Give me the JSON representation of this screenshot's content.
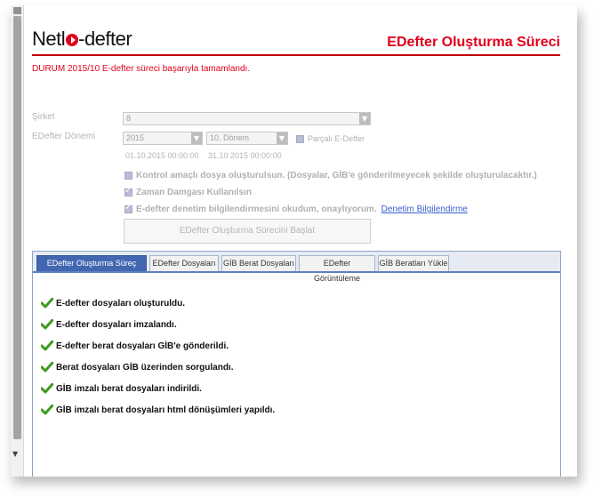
{
  "header": {
    "logo_left": "Netl",
    "logo_right": "-defter",
    "title": "EDefter Oluşturma Süreci"
  },
  "status": "DURUM 2015/10 E-defter süreci başarıyla tamamlandı.",
  "form": {
    "company_label": "Şirket",
    "company_value": "8",
    "period_label": "EDefter Dönemi",
    "year_value": "2015",
    "period_value": "10. Dönem",
    "partial_label": "Parçalı E-Defter",
    "start_date": "01.10.2015 00:00:00",
    "end_date": "31.10.2015 00:00:00",
    "check_control": "Kontrol amaçlı dosya oluşturulsun. (Dosyalar, GİB'e gönderilmeyecek şekilde oluşturulacaktır.)",
    "check_timestamp": "Zaman Damgası Kullanılsın",
    "check_agree": "E-defter denetim bilgilendirmesini okudum, onaylıyorum.",
    "agree_link": "Denetim Bilgilendirme",
    "start_button": "EDefter Oluşturma Sürecini Başlat"
  },
  "tabs": [
    {
      "label": "EDefter Oluşturma Süreç Geçmişi",
      "active": true
    },
    {
      "label": "EDefter Dosyaları",
      "active": false
    },
    {
      "label": "GİB Berat Dosyaları",
      "active": false
    },
    {
      "label": "EDefter Görüntüleme",
      "active": false
    },
    {
      "label": "GİB Beratları Yükle",
      "active": false
    }
  ],
  "steps": [
    "E-defter dosyaları oluşturuldu.",
    "E-defter dosyaları imzalandı.",
    "E-defter berat dosyaları GİB'e gönderildi.",
    "Berat dosyaları GİB üzerinden sorgulandı.",
    "GİB imzalı berat dosyaları indirildi.",
    "GİB imzalı berat dosyaları html dönüşümleri yapıldı."
  ],
  "colors": {
    "brand_red": "#e0001b",
    "tab_active": "#4267b0",
    "check_green": "#3c9a1e"
  },
  "icons": {
    "step_icon": "checkmark-icon",
    "dropdown_icon": "chevron-down-icon"
  }
}
